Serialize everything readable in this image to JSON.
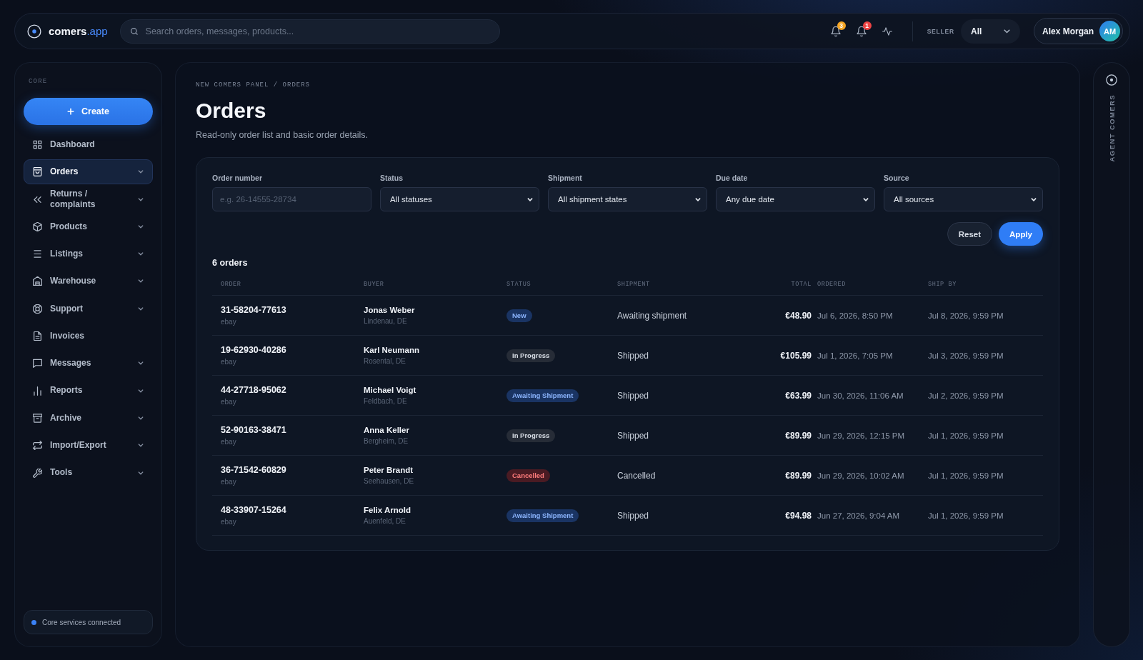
{
  "topbar": {
    "brand": {
      "name": "comers",
      "suffix": ".app"
    },
    "search": {
      "placeholder": "Search orders, messages, products..."
    },
    "notifications": [
      {
        "count": "3",
        "color": "#f5a524"
      },
      {
        "count": "1",
        "color": "#ef4444"
      }
    ],
    "seller": {
      "label": "SELLER",
      "value": "All"
    },
    "user": {
      "name": "Alex Morgan",
      "initials": "AM"
    }
  },
  "sidebar": {
    "section": "CORE",
    "create_button": "Create",
    "items": [
      {
        "label": "Dashboard",
        "selected": false,
        "expandable": false
      },
      {
        "label": "Orders",
        "selected": true,
        "expandable": true
      },
      {
        "label": "Returns / complaints",
        "selected": false,
        "expandable": true
      },
      {
        "label": "Products",
        "selected": false,
        "expandable": true
      },
      {
        "label": "Listings",
        "selected": false,
        "expandable": true
      },
      {
        "label": "Warehouse",
        "selected": false,
        "expandable": true
      },
      {
        "label": "Support",
        "selected": false,
        "expandable": true
      },
      {
        "label": "Invoices",
        "selected": false,
        "expandable": false
      },
      {
        "label": "Messages",
        "selected": false,
        "expandable": true
      },
      {
        "label": "Reports",
        "selected": false,
        "expandable": true
      },
      {
        "label": "Archive",
        "selected": false,
        "expandable": true
      },
      {
        "label": "Import/Export",
        "selected": false,
        "expandable": true
      },
      {
        "label": "Tools",
        "selected": false,
        "expandable": true
      }
    ],
    "status": "Core services connected"
  },
  "page": {
    "breadcrumb": "NEW COMERS PANEL / ORDERS",
    "title": "Orders",
    "subtitle": "Read-only order list and basic order details."
  },
  "filters": {
    "fields": [
      {
        "label": "Order number",
        "kind": "input",
        "placeholder": "e.g. 26-14555-28734"
      },
      {
        "label": "Status",
        "kind": "select",
        "value": "All statuses"
      },
      {
        "label": "Shipment",
        "kind": "select",
        "value": "All shipment states"
      },
      {
        "label": "Due date",
        "kind": "select",
        "value": "Any due date"
      },
      {
        "label": "Source",
        "kind": "select",
        "value": "All sources"
      }
    ],
    "buttons": [
      {
        "label": "Reset",
        "kind": "secondary"
      },
      {
        "label": "Apply",
        "kind": "primary"
      }
    ]
  },
  "orders": {
    "count": "6 orders",
    "columns": [
      {
        "label": "ORDER"
      },
      {
        "label": "BUYER"
      },
      {
        "label": "STATUS"
      },
      {
        "label": "SHIPMENT"
      },
      {
        "label": "TOTAL"
      },
      {
        "label": "ORDERED"
      },
      {
        "label": "SHIP BY"
      }
    ],
    "rows": [
      {
        "order": "31-58204-77613",
        "source": "ebay",
        "buyer": "Jonas Weber",
        "location": "Lindenau, DE",
        "status": {
          "label": "New",
          "kind": "new"
        },
        "shipment": "Awaiting shipment",
        "total": "€48.90",
        "ordered": "Jul 6, 2026, 8:50 PM",
        "ship_by": "Jul 8, 2026, 9:59 PM"
      },
      {
        "order": "19-62930-40286",
        "source": "ebay",
        "buyer": "Karl Neumann",
        "location": "Rosental, DE",
        "status": {
          "label": "In Progress",
          "kind": "progress"
        },
        "shipment": "Shipped",
        "total": "€105.99",
        "ordered": "Jul 1, 2026, 7:05 PM",
        "ship_by": "Jul 3, 2026, 9:59 PM"
      },
      {
        "order": "44-27718-95062",
        "source": "ebay",
        "buyer": "Michael Voigt",
        "location": "Feldbach, DE",
        "status": {
          "label": "Awaiting Shipment",
          "kind": "awaiting"
        },
        "shipment": "Shipped",
        "total": "€63.99",
        "ordered": "Jun 30, 2026, 11:06 AM",
        "ship_by": "Jul 2, 2026, 9:59 PM"
      },
      {
        "order": "52-90163-38471",
        "source": "ebay",
        "buyer": "Anna Keller",
        "location": "Bergheim, DE",
        "status": {
          "label": "In Progress",
          "kind": "progress"
        },
        "shipment": "Shipped",
        "total": "€89.99",
        "ordered": "Jun 29, 2026, 12:15 PM",
        "ship_by": "Jul 1, 2026, 9:59 PM"
      },
      {
        "order": "36-71542-60829",
        "source": "ebay",
        "buyer": "Peter Brandt",
        "location": "Seehausen, DE",
        "status": {
          "label": "Cancelled",
          "kind": "cancelled"
        },
        "shipment": "Cancelled",
        "total": "€89.99",
        "ordered": "Jun 29, 2026, 10:02 AM",
        "ship_by": "Jul 1, 2026, 9:59 PM"
      },
      {
        "order": "48-33907-15264",
        "source": "ebay",
        "buyer": "Felix Arnold",
        "location": "Auenfeld, DE",
        "status": {
          "label": "Awaiting Shipment",
          "kind": "awaiting"
        },
        "shipment": "Shipped",
        "total": "€94.98",
        "ordered": "Jun 27, 2026, 9:04 AM",
        "ship_by": "Jul 1, 2026, 9:59 PM"
      }
    ]
  },
  "agent_panel": {
    "title": "AGENT COMERS"
  }
}
